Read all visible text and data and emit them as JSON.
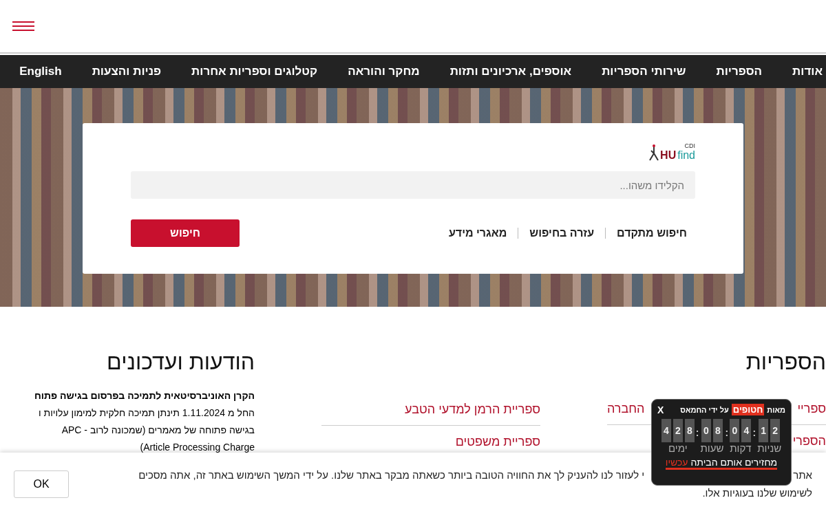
{
  "nav": {
    "items": [
      "אודות",
      "הספריות",
      "שירותי הספריות",
      "אוספים, ארכיונים ותזות",
      "מחקר והוראה",
      "קטלוגים וספריות אחרות",
      "פניות והצעות",
      "English"
    ]
  },
  "search_card": {
    "logo": {
      "main": "HU",
      "accent": "find",
      "super": "CDI"
    },
    "placeholder": "הקלידו משהו...",
    "links": [
      "חיפוש מתקדם",
      "עזרה בחיפוש",
      "מאגרי מידע"
    ],
    "button": "חיפוש"
  },
  "libraries": {
    "title": "הספריות",
    "links": [
      {
        "start": "ספריי",
        "end": "החברה"
      },
      {
        "start": "הספרי"
      }
    ]
  },
  "middle_links": [
    "ספריית הרמן למדעי הטבע",
    "ספריית משפטים"
  ],
  "news": {
    "title": "הודעות ועדכונים",
    "headline": "הקרן האוניברסיטאית לתמיכה בפרסום בגישה פתוח",
    "lines": [
      "החל מ 1.11.2024 תינתן תמיכה חלקית למימון עלויות ו",
      "בגישה פתוחה של מאמרים (שמכונה לרוב - APC",
      "(Article Processing Charge"
    ]
  },
  "cookie_bar": {
    "line1_start": "אתר",
    "line1_rest": "י לעזור לנו להעניק לך את החוויה הטובה ביותר כשאתה מבקר באתר שלנו. על ידי המשך השימוש באתר זה, אתה מסכים",
    "line2": "לשימוש שלנו בעוגיות אלו.",
    "button": "OK"
  },
  "countdown_popup": {
    "close": "X",
    "title": [
      "מאות",
      "חטופים",
      "על ידי החמאס"
    ],
    "groups": [
      {
        "digits": [
          "2",
          "1"
        ],
        "label": "שניות"
      },
      {
        "digits": [
          "4",
          "0"
        ],
        "label": "דקות"
      },
      {
        "digits": [
          "8",
          "0"
        ],
        "label": "שעות"
      },
      {
        "digits": [
          "8",
          "2",
          "4"
        ],
        "label": "ימים"
      }
    ],
    "separator": ":",
    "link": "מחזירים אותם הביתה",
    "link_highlight": "עכשיו"
  }
}
